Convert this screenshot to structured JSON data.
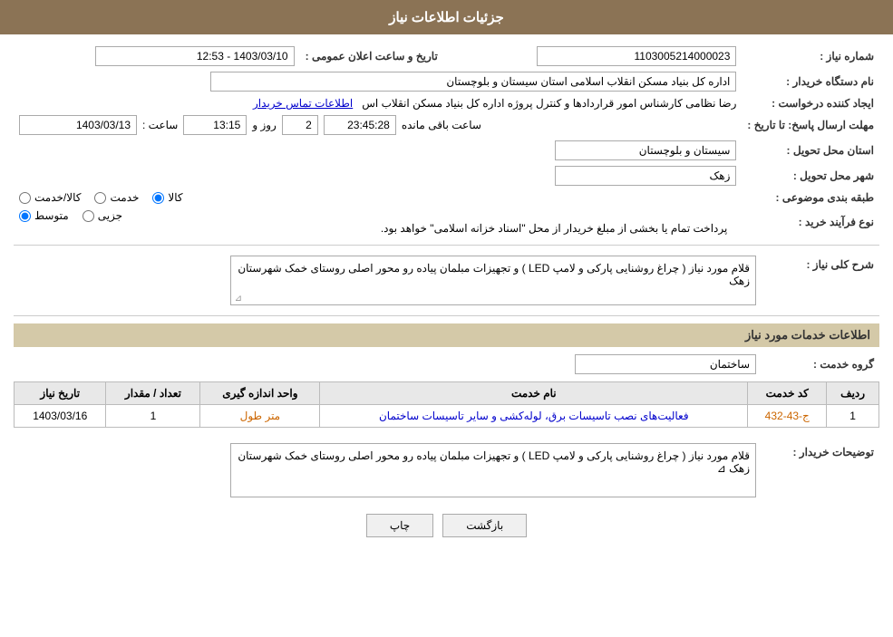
{
  "header": {
    "title": "جزئیات اطلاعات نیاز"
  },
  "fields": {
    "need_number_label": "شماره نیاز :",
    "need_number_value": "1103005214000023",
    "buyer_org_label": "نام دستگاه خریدار :",
    "buyer_org_value": "اداره کل بنیاد مسکن انقلاب اسلامی استان سیستان و بلوچستان",
    "creator_label": "ایجاد کننده درخواست :",
    "creator_value": "رضا نظامی کارشناس امور قراردادها و کنترل پروژه اداره کل بنیاد مسکن انقلاب اس",
    "creator_link": "اطلاعات تماس خریدار",
    "response_deadline_label": "مهلت ارسال پاسخ: تا تاریخ :",
    "response_date": "1403/03/13",
    "response_time_label": "ساعت :",
    "response_time": "13:15",
    "response_days_label": "روز و",
    "response_days": "2",
    "response_remaining_label": "ساعت باقی مانده",
    "response_remaining": "23:45:28",
    "announce_date_label": "تاریخ و ساعت اعلان عمومی :",
    "announce_date": "1403/03/10 - 12:53",
    "province_label": "استان محل تحویل :",
    "province_value": "سیستان و بلوچستان",
    "city_label": "شهر محل تحویل :",
    "city_value": "زهک",
    "category_label": "طبقه بندی موضوعی :",
    "category_kala": "کالا",
    "category_khedmat": "خدمت",
    "category_kala_khedmat": "کالا/خدمت",
    "category_selected": "kala",
    "purchase_type_label": "نوع فرآیند خرید :",
    "purchase_jozii": "جزیی",
    "purchase_motovaset": "متوسط",
    "purchase_desc": "پرداخت تمام یا بخشی از مبلغ خریدار از محل \"اسناد خزانه اسلامی\" خواهد بود.",
    "purchase_selected": "motovaset",
    "general_desc_label": "شرح کلی نیاز :",
    "general_desc_value": "قلام مورد نیاز ( چراغ روشنایی پارکی و لامپ LED ) و تجهیزات مبلمان پیاده رو محور اصلی روستای خمک شهرستان زهک",
    "services_section_title": "اطلاعات خدمات مورد نیاز",
    "service_group_label": "گروه خدمت :",
    "service_group_value": "ساختمان",
    "table": {
      "col_row": "ردیف",
      "col_code": "کد خدمت",
      "col_name": "نام خدمت",
      "col_unit": "واحد اندازه گیری",
      "col_count": "تعداد / مقدار",
      "col_date": "تاریخ نیاز",
      "rows": [
        {
          "row": "1",
          "code": "ج-43-432",
          "name": "فعالیت‌های نصب تاسیسات برق، لوله‌کشی و سایر تاسیسات ساختمان",
          "unit": "متر طول",
          "count": "1",
          "date": "1403/03/16"
        }
      ]
    },
    "buyer_desc_label": "توضیحات خریدار :",
    "buyer_desc_value": "قلام مورد نیاز ( چراغ روشنایی پارکی و لامپ LED ) و تجهیزات مبلمان پیاده رو محور اصلی روستای خمک شهرستان زهک",
    "btn_print": "چاپ",
    "btn_back": "بازگشت"
  }
}
